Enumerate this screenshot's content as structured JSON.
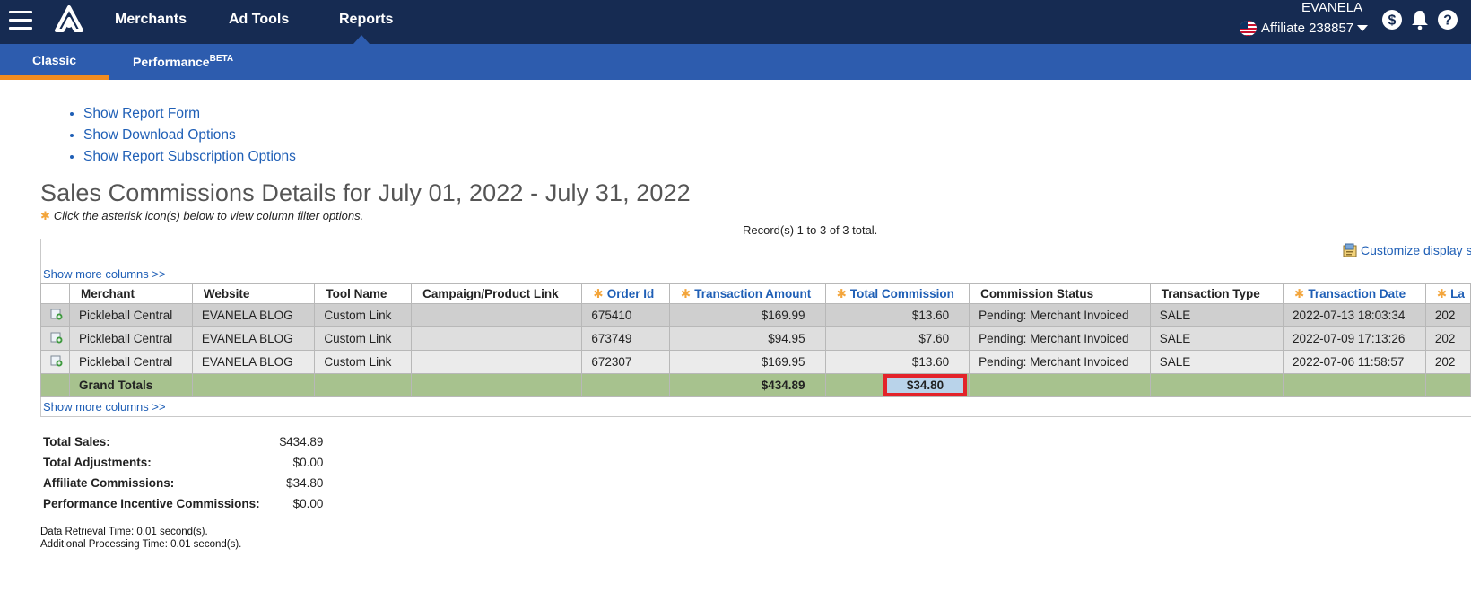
{
  "nav": {
    "items": [
      "Merchants",
      "Ad Tools",
      "Reports"
    ],
    "user_name": "EVANELA",
    "affiliate_label": "Affiliate 238857"
  },
  "subnav": {
    "classic": "Classic",
    "performance": "Performance",
    "performance_badge": "BETA"
  },
  "links": [
    "Show Report Form",
    "Show Download Options",
    "Show Report Subscription Options"
  ],
  "report": {
    "title": "Sales Commissions Details for July 01, 2022 - July 31, 2022",
    "hint": "Click the asterisk icon(s) below to view column filter options.",
    "asterisk": "✱",
    "records": "Record(s) 1 to 3 of 3 total.",
    "customize": "Customize display s",
    "show_more": "Show more columns >>"
  },
  "table": {
    "headers": [
      "Merchant",
      "Website",
      "Tool Name",
      "Campaign/Product Link",
      "Order Id",
      "Transaction Amount",
      "Total Commission",
      "Commission Status",
      "Transaction Type",
      "Transaction Date",
      "La"
    ],
    "rows": [
      [
        "Pickleball Central",
        "EVANELA BLOG",
        "Custom Link",
        "",
        "675410",
        "$169.99",
        "$13.60",
        "Pending: Merchant Invoiced",
        "SALE",
        "2022-07-13 18:03:34",
        "202"
      ],
      [
        "Pickleball Central",
        "EVANELA BLOG",
        "Custom Link",
        "",
        "673749",
        "$94.95",
        "$7.60",
        "Pending: Merchant Invoiced",
        "SALE",
        "2022-07-09 17:13:26",
        "202"
      ],
      [
        "Pickleball Central",
        "EVANELA BLOG",
        "Custom Link",
        "",
        "672307",
        "$169.95",
        "$13.60",
        "Pending: Merchant Invoiced",
        "SALE",
        "2022-07-06 11:58:57",
        "202"
      ]
    ],
    "totals": {
      "label": "Grand Totals",
      "transaction_amount": "$434.89",
      "total_commission": "$34.80"
    }
  },
  "summary": [
    {
      "label": "Total Sales:",
      "value": "$434.89"
    },
    {
      "label": "Total Adjustments:",
      "value": "$0.00"
    },
    {
      "label": "Affiliate Commissions:",
      "value": "$34.80"
    },
    {
      "label": "Performance Incentive Commissions:",
      "value": "$0.00"
    }
  ],
  "perf": {
    "retrieval": "Data Retrieval Time: 0.01 second(s).",
    "processing": "Additional Processing Time: 0.01 second(s)."
  },
  "colors": {
    "topbar": "#162b52",
    "subnav": "#2d5cae",
    "active_tab": "#f28c1f",
    "link": "#1f5fb6",
    "totals_row": "#a7c28e",
    "highlight_border": "#e3232a"
  },
  "icons": [
    "hamburger-icon",
    "logo-icon",
    "us-flag-icon",
    "dollar-icon",
    "bell-icon",
    "help-icon",
    "customize-icon",
    "row-detail-icon"
  ]
}
